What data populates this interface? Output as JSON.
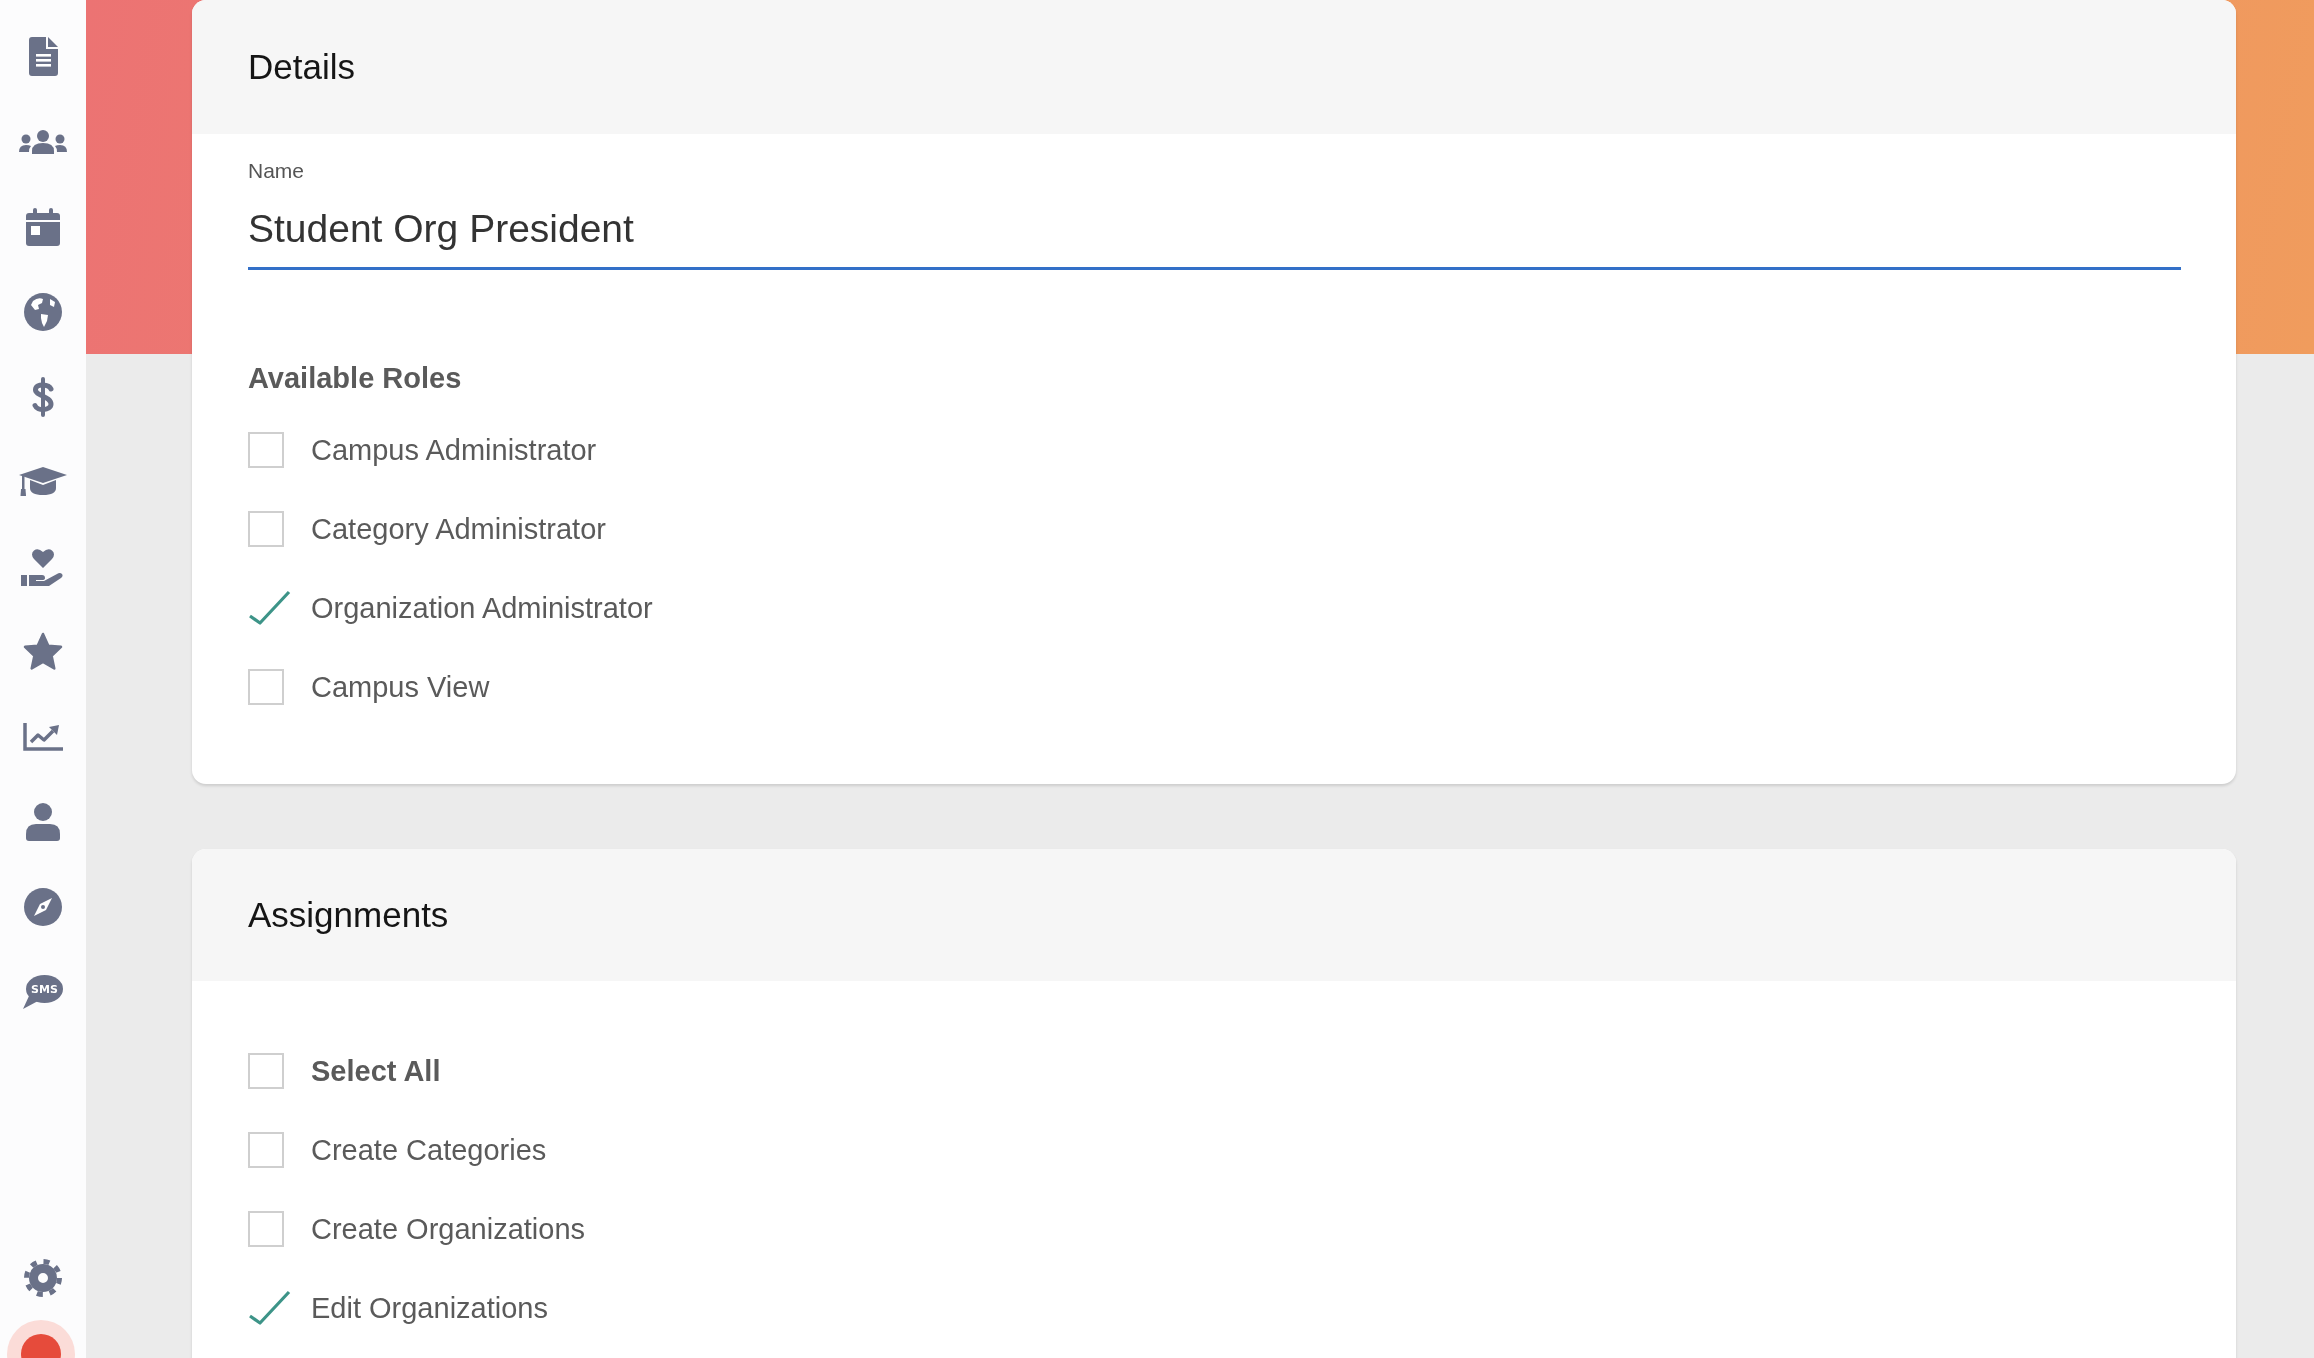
{
  "sidebar": {
    "sms_label": "SMS"
  },
  "details": {
    "title": "Details",
    "name_field": {
      "label": "Name",
      "value": "Student Org President",
      "focused": true
    },
    "roles": {
      "heading": "Available Roles",
      "items": [
        {
          "label": "Campus Administrator",
          "checked": false
        },
        {
          "label": "Category Administrator",
          "checked": false
        },
        {
          "label": "Organization Administrator",
          "checked": true
        },
        {
          "label": "Campus View",
          "checked": false
        }
      ]
    }
  },
  "assignments": {
    "title": "Assignments",
    "items": [
      {
        "kind": "select_all",
        "label": "Select All",
        "checked": false
      },
      {
        "kind": "option",
        "label": "Create Categories",
        "checked": false
      },
      {
        "kind": "option",
        "label": "Create Organizations",
        "checked": false
      },
      {
        "kind": "option",
        "label": "Edit Organizations",
        "checked": true
      }
    ]
  }
}
